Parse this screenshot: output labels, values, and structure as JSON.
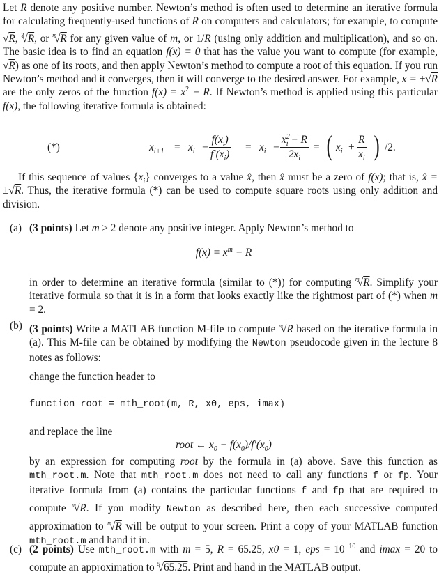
{
  "intro": {
    "p1": [
      "Let ",
      "R",
      " denote any positive number. Newton’s method is often used to determine an iterative formula for calculating frequently-used functions of ",
      "R",
      " on computers and calculators; for example, to compute ",
      "R",
      ", ",
      "3",
      "R",
      ", or ",
      "m",
      "R",
      " for any given value of ",
      "m",
      ", or 1/",
      "R",
      " (using only addition and multiplication), and so on. The basic idea is to find an equation ",
      "f(x) = 0",
      " that has the value you want to compute (for example, ",
      "R",
      ") as one of its roots, and then apply Newton’s method to compute a root of this equation. If you run Newton’s method and it converges, then it will converge to the desired answer. For example, ",
      "x = ±",
      "R",
      " are the only zeros of the function ",
      "f(x) = x",
      "2",
      " − R",
      ". If Newton’s method is applied using this particular ",
      "f(x)",
      ", the following iterative formula is obtained:"
    ]
  },
  "formula_star": {
    "tag": "(*)",
    "lhs": "x",
    "lhs_sub": "i+1",
    "eq1": "=",
    "xi": "x",
    "xi_sub": "i",
    "minus": "−",
    "frac1_num": "f(x",
    "frac1_num_sub": "i",
    "frac1_num_end": ")",
    "frac1_den": "f′(x",
    "frac1_den_sub": "i",
    "frac1_den_end": ")",
    "eq2": "=",
    "frac2_num_x": "x",
    "frac2_num_sup": "2",
    "frac2_num_sub": "i",
    "frac2_num_end": " − R",
    "frac2_den": "2x",
    "frac2_den_sub": "i",
    "eq3": "=",
    "plus": "+",
    "frac3_num": "R",
    "frac3_den": "x",
    "frac3_den_sub": "i",
    "tail": "/2."
  },
  "after_formula": {
    "t1": "If this sequence of values {",
    "t2": "x",
    "t3": "i",
    "t4": "} converges to a value ",
    "t5": "x̂",
    "t6": ", then ",
    "t7": "x̂",
    "t8": " must be a zero of ",
    "t9": "f(x)",
    "t10": "; that is, ",
    "t11": "x̂ = ±",
    "t12": "R",
    "t13": ". Thus, the iterative formula (*) can be used to compute square roots using only addition and division."
  },
  "part_a": {
    "label": "(a)",
    "points": "(3 points)",
    "t1": " Let ",
    "m": "m",
    "t2": " ≥ 2 denote any positive integer. Apply Newton’s method to",
    "equation": "f(x) = x",
    "equation_sup": "m",
    "equation_end": " − R",
    "t3": "in order to determine an iterative formula (similar to (*)) for computing ",
    "root_idx": "m",
    "root_rad": "R",
    "t4": ". Simplify your iterative formula so that it is in a form that looks exactly like the rightmost part of (*) when ",
    "t5": "m",
    "t6": " = 2."
  },
  "part_b": {
    "label": "(b)",
    "points": "(3 points)",
    "t1": " Write a MATLAB function M-file to compute ",
    "root_idx": "m",
    "root_rad": "R",
    "t2": " based on the iterative formula in (a). This M-file can be obtained by modifying the ",
    "newton": "Newton",
    "t3": " pseudocode given in the lecture 8 notes as follows:",
    "change_header": "change the function header to",
    "code": "function root = mth_root(m, R, x0, eps, imax)",
    "replace_line": "and replace the line",
    "pseudo": "root ← x",
    "pseudo_sub1": "0",
    "pseudo_mid": " − f(x",
    "pseudo_sub2": "0",
    "pseudo_mid2": ")/f′(x",
    "pseudo_sub3": "0",
    "pseudo_end": ")",
    "t4": "by an expression for computing ",
    "root_word": "root",
    "t5": " by the formula in (a) above. Save this function as ",
    "file1": "mth_root.m",
    "t6": ". Note that ",
    "file2": "mth_root.m",
    "t7": " does not need to call any functions ",
    "f": "f",
    "t8": " or ",
    "fp": "fp",
    "t9": ". Your iterative formula from (a) contains the particular functions ",
    "f2": "f",
    "t10": " and ",
    "fp2": "fp",
    "t11": " that are required to compute ",
    "t12": ". If you modify ",
    "newton2": "Newton",
    "t13": " as described here, then each successive computed approximation to ",
    "t14": " will be output to your screen. Print a copy of your MATLAB function ",
    "file3": "mth_root.m",
    "t15": " and hand it in."
  },
  "part_c": {
    "label": "(c)",
    "points": "(2 points)",
    "t1": " Use ",
    "file": "mth_root.m",
    "t2": " with ",
    "m": "m",
    "t3": " = 5, ",
    "R": "R",
    "t4": " = 65.25, ",
    "x0": "x0",
    "t5": " = 1, ",
    "eps": "eps",
    "t6": " = 10",
    "exp": "−10",
    "t7": " and ",
    "imax": "imax",
    "t8": " = 20 to compute an approximation to ",
    "root_idx": "5",
    "root_rad": "65.25",
    "t9": ". Print and hand in the MATLAB output."
  }
}
